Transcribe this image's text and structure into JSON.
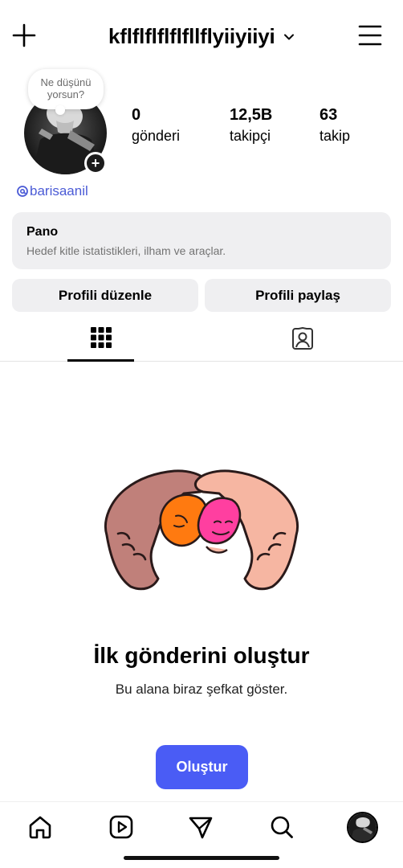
{
  "header": {
    "username": "kflflflflflfllflyiiyiiyi",
    "icons": {
      "create": "plus-icon",
      "account_switch": "chevron-down-icon",
      "menu": "hamburger-icon"
    }
  },
  "profile": {
    "note": "Ne düşünü yorsun?",
    "avatar_add": "+",
    "stats": [
      {
        "value": "0",
        "label": "gönderi"
      },
      {
        "value": "12,5B",
        "label": "takipçi"
      },
      {
        "value": "63",
        "label": "takip"
      }
    ],
    "threads_handle": "barisaanil"
  },
  "dashboard": {
    "title": "Pano",
    "subtitle": "Hedef kitle istatistikleri, ilham ve araçlar."
  },
  "actions": {
    "edit_profile": "Profili düzenle",
    "share_profile": "Profili paylaş"
  },
  "tabs": [
    {
      "icon": "grid-icon",
      "active": true
    },
    {
      "icon": "tagged-person-icon",
      "active": false
    }
  ],
  "empty_state": {
    "title": "İlk gönderini oluştur",
    "subtitle": "Bu alana biraz şefkat göster.",
    "button": "Oluştur"
  },
  "bottom_nav": [
    {
      "icon": "home-icon"
    },
    {
      "icon": "reels-icon"
    },
    {
      "icon": "send-icon"
    },
    {
      "icon": "search-icon"
    },
    {
      "icon": "profile-avatar"
    }
  ],
  "colors": {
    "accent": "#4a5cf5",
    "link": "#4b5bd6",
    "card_bg": "#efeff1"
  }
}
